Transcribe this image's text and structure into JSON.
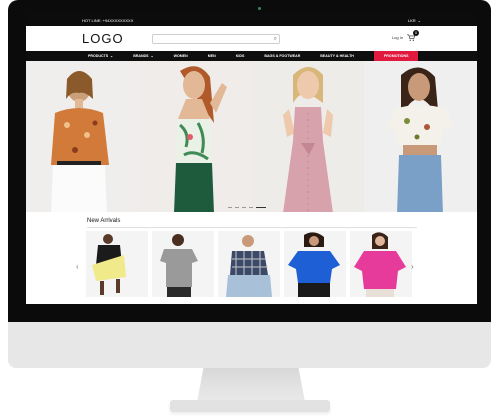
{
  "topbar": {
    "hotline": "HOT LINE: +94XXXXXXXXX",
    "currency": "LKR"
  },
  "header": {
    "logo": "LOGO",
    "search_placeholder": "",
    "login_label": "Log In",
    "cart_count": "0"
  },
  "nav": {
    "items": [
      {
        "label": "PRODUCTS",
        "dropdown": true
      },
      {
        "label": "BRANDS",
        "dropdown": true
      },
      {
        "label": "WOMEN",
        "dropdown": false
      },
      {
        "label": "MEN",
        "dropdown": false
      },
      {
        "label": "KIDS",
        "dropdown": false
      },
      {
        "label": "BAGS & FOOTWEAR",
        "dropdown": false
      },
      {
        "label": "BEAUTY & HEALTH",
        "dropdown": false
      }
    ],
    "promo": "PROMOTIONS"
  },
  "hero": {
    "slides": [
      "floral-blouse-model",
      "halter-top-model",
      "pink-dress-model",
      "crop-top-model"
    ],
    "dots_count": 5,
    "active_dot": 3
  },
  "arrivals": {
    "title": "New Arrivals",
    "products": [
      "yellow-shorts-outfit",
      "grey-tshirt-outfit",
      "plaid-shirt-outfit",
      "blue-blouse-outfit",
      "pink-blouse-outfit"
    ]
  },
  "colors": {
    "promo_red": "#e0193f",
    "nav_bg": "#0e0e0e",
    "topbar_bg": "#0c0c0c"
  }
}
